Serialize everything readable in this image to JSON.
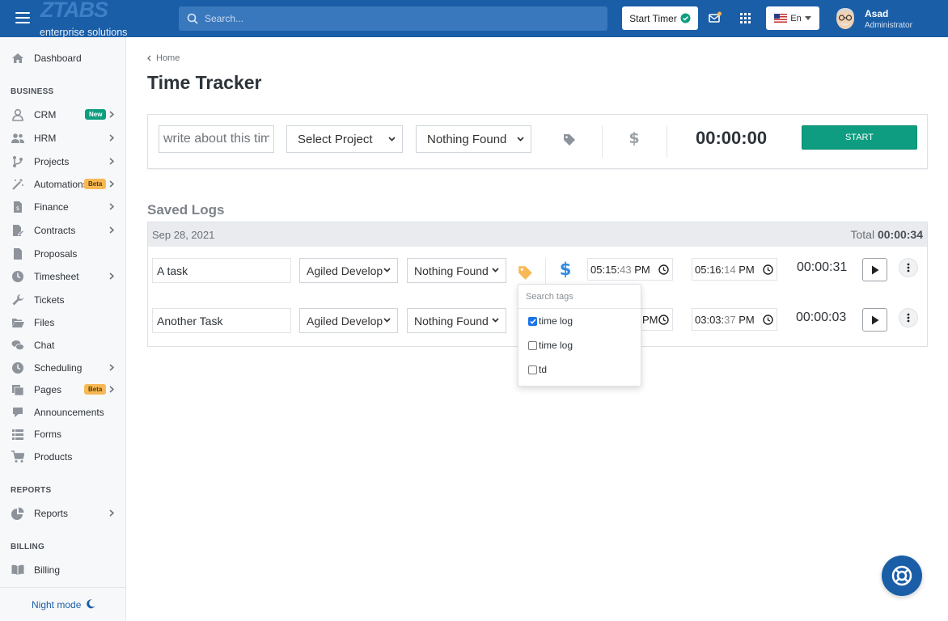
{
  "topbar": {
    "logo_main": "ZTABS",
    "logo_sub": "enterprise solutions",
    "search_placeholder": "Search...",
    "start_timer_label": "Start Timer",
    "language": "En",
    "user_name": "Asad",
    "user_role": "Administrator"
  },
  "sidebar": {
    "dashboard": "Dashboard",
    "section_business": "BUSINESS",
    "crm": "CRM",
    "crm_badge": "New",
    "hrm": "HRM",
    "projects": "Projects",
    "automations": "Automations",
    "automations_badge": "Beta",
    "finance": "Finance",
    "contracts": "Contracts",
    "proposals": "Proposals",
    "timesheet": "Timesheet",
    "tickets": "Tickets",
    "files": "Files",
    "chat": "Chat",
    "scheduling": "Scheduling",
    "pages": "Pages",
    "pages_badge": "Beta",
    "announcements": "Announcements",
    "forms": "Forms",
    "products": "Products",
    "section_reports": "REPORTS",
    "reports": "Reports",
    "section_billing": "BILLING",
    "billing": "Billing",
    "night_mode": "Night mode"
  },
  "main": {
    "breadcrumb": "Home",
    "title": "Time Tracker",
    "tracker": {
      "description_placeholder": "write about this timer",
      "project_select": "Select Project",
      "task_select": "Nothing Found",
      "timer": "00:00:00",
      "start_label": "START"
    },
    "saved_logs_title": "Saved Logs",
    "log_group": {
      "date": "Sep 28, 2021",
      "total_label": "Total",
      "total_value": "00:00:34"
    },
    "logs": [
      {
        "name": "A task",
        "project": "Agiled Develop",
        "task": "Nothing Found",
        "start_hm": "05:15:",
        "start_s": "43",
        "start_ampm": "PM",
        "end_hm": "05:16:",
        "end_s": "14",
        "end_ampm": "PM",
        "duration": "00:00:31"
      },
      {
        "name": "Another Task",
        "project": "Agiled Develop",
        "task": "Nothing Found",
        "start_ampm": "PM",
        "end_hm": "03:03:",
        "end_s": "37",
        "end_ampm": "PM",
        "duration": "00:00:03"
      }
    ],
    "tag_dropdown": {
      "search_placeholder": "Search tags",
      "options": [
        {
          "label": "time log",
          "checked": true
        },
        {
          "label": "time log",
          "checked": false
        },
        {
          "label": "td",
          "checked": false
        }
      ]
    }
  },
  "colors": {
    "primary": "#1a5ea8",
    "accent_green": "#0e9d80",
    "badge_beta": "#f7b955",
    "tag_orange": "#f7b955",
    "dollar_blue": "#2d8ae0"
  }
}
